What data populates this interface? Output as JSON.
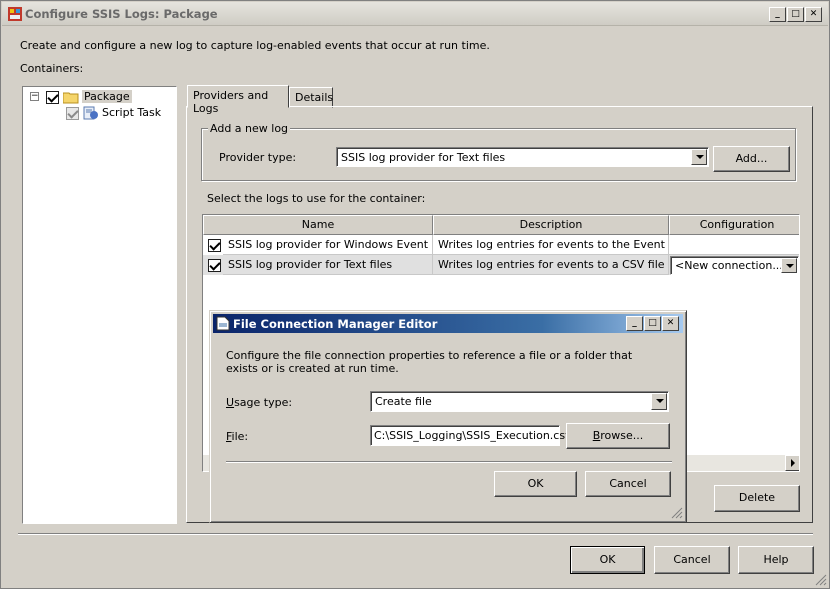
{
  "window": {
    "title": "Configure SSIS Logs: Package",
    "description": "Create and configure a new log to capture log-enabled events that occur at run time.",
    "containers_label": "Containers:"
  },
  "tree": {
    "items": [
      {
        "label": "Package",
        "checked": true
      },
      {
        "label": "Script Task",
        "checked": true
      }
    ]
  },
  "tabs": [
    {
      "label": "Providers and Logs",
      "active": true
    },
    {
      "label": "Details",
      "active": false
    }
  ],
  "add_log": {
    "group_label": "Add a new log",
    "provider_type_label": "Provider type:",
    "provider_type_value": "SSIS log provider for Text files",
    "add_button": "Add..."
  },
  "logs": {
    "select_label": "Select the logs to use for the container:",
    "columns": [
      "Name",
      "Description",
      "Configuration"
    ],
    "rows": [
      {
        "checked": true,
        "name": "SSIS log provider for Windows Event Log",
        "description": "Writes log entries for events to the Event Log",
        "configuration": ""
      },
      {
        "checked": true,
        "name": "SSIS log provider for Text files",
        "description": "Writes log entries for events to a CSV file",
        "configuration": "<New connection...."
      }
    ],
    "delete_button": "Delete"
  },
  "dialog": {
    "title": "File Connection Manager Editor",
    "description": "Configure the file connection properties to reference a file or a folder that exists or is created at run time.",
    "usage_type_label_pre": "",
    "usage_type_label_ul": "U",
    "usage_type_label_post": "sage type:",
    "usage_type_value": "Create file",
    "file_label_ul": "F",
    "file_label_post": "ile:",
    "file_value": "C:\\SSIS_Logging\\SSIS_Execution.csv",
    "browse_pre": "",
    "browse_ul": "B",
    "browse_post": "rowse...",
    "ok_button": "OK",
    "cancel_button": "Cancel"
  },
  "footer": {
    "ok_button": "OK",
    "cancel_button": "Cancel",
    "help_button": "Help"
  }
}
